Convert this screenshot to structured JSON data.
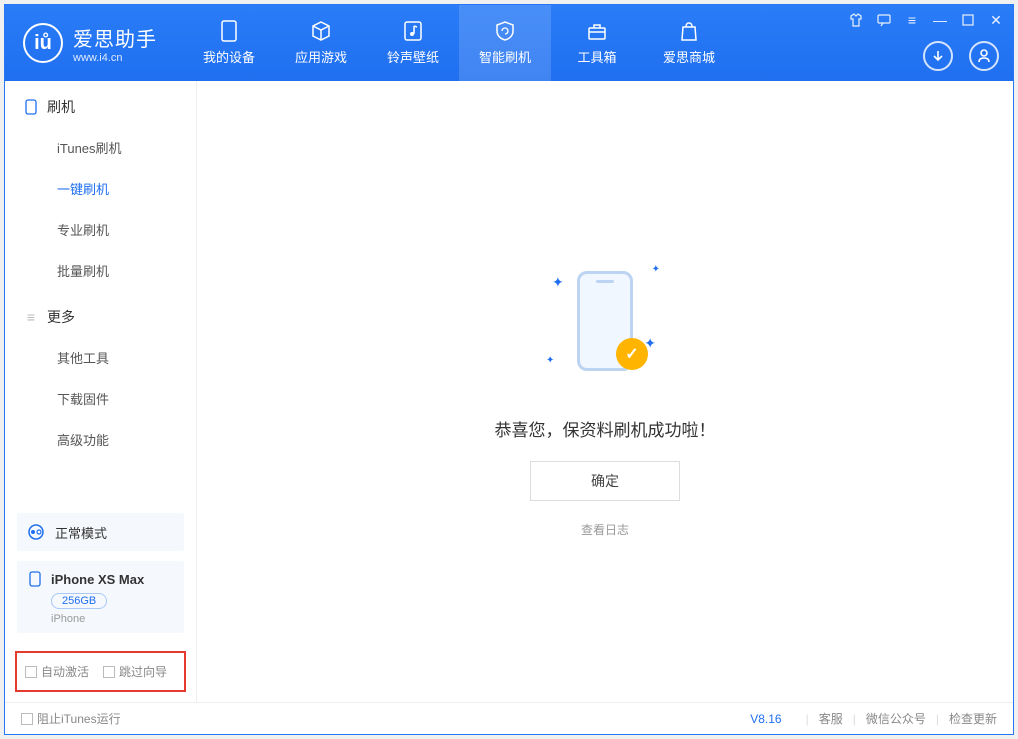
{
  "brand": {
    "name": "爱思助手",
    "site": "www.i4.cn"
  },
  "tabs": [
    {
      "label": "我的设备"
    },
    {
      "label": "应用游戏"
    },
    {
      "label": "铃声壁纸"
    },
    {
      "label": "智能刷机"
    },
    {
      "label": "工具箱"
    },
    {
      "label": "爱思商城"
    }
  ],
  "sidebar": {
    "group1": {
      "title": "刷机",
      "items": [
        "iTunes刷机",
        "一键刷机",
        "专业刷机",
        "批量刷机"
      ]
    },
    "group2": {
      "title": "更多",
      "items": [
        "其他工具",
        "下载固件",
        "高级功能"
      ]
    }
  },
  "mode": {
    "label": "正常模式"
  },
  "device": {
    "name": "iPhone XS Max",
    "capacity": "256GB",
    "type": "iPhone"
  },
  "options": {
    "auto_activate": "自动激活",
    "skip_guide": "跳过向导"
  },
  "main": {
    "message": "恭喜您，保资料刷机成功啦！",
    "ok": "确定",
    "view_log": "查看日志"
  },
  "footer": {
    "block_itunes": "阻止iTunes运行",
    "version": "V8.16",
    "service": "客服",
    "wechat": "微信公众号",
    "update": "检查更新"
  }
}
